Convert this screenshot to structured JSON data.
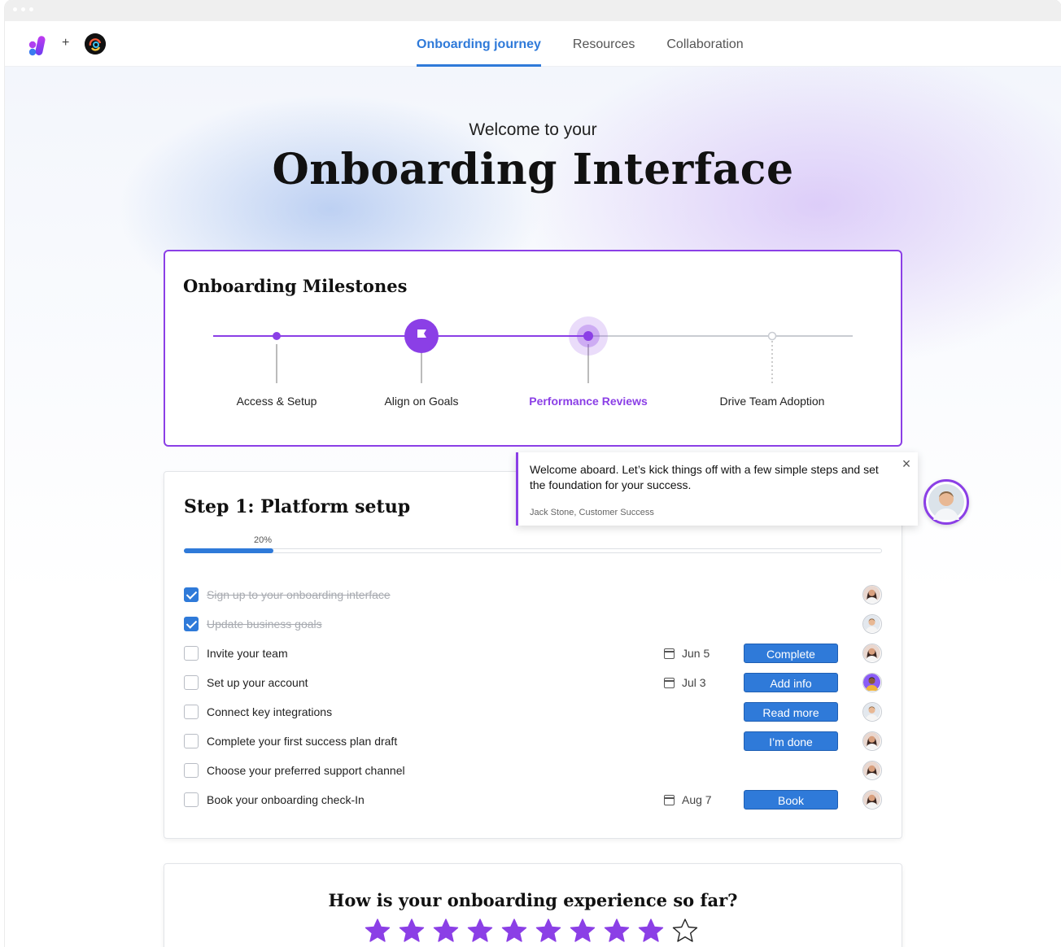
{
  "nav": {
    "plus": "+",
    "tabs": [
      {
        "label": "Onboarding journey",
        "active": true
      },
      {
        "label": "Resources",
        "active": false
      },
      {
        "label": "Collaboration",
        "active": false
      }
    ]
  },
  "hero": {
    "welcome": "Welcome to your",
    "title": "Onboarding Interface"
  },
  "milestones": {
    "title": "Onboarding Milestones",
    "items": [
      {
        "label": "Access & Setup",
        "state": "done"
      },
      {
        "label": "Align on Goals",
        "state": "done",
        "icon": "flag-icon"
      },
      {
        "label": "Performance Reviews",
        "state": "current"
      },
      {
        "label": "Drive Team Adoption",
        "state": "upcoming"
      }
    ],
    "accent": "#8b3fe6"
  },
  "tooltip": {
    "message": "Welcome aboard. Let’s kick things off with a few simple steps and set the foundation for your success.",
    "author": "Jack Stone, Customer Success",
    "close": "×"
  },
  "step": {
    "title": "Step 1: Platform setup",
    "progress_label": "20%",
    "progress": 0.126,
    "tasks": [
      {
        "label": "Sign up to your onboarding interface",
        "done": true,
        "date": "",
        "button": "",
        "avatar": "woman"
      },
      {
        "label": "Update business goals",
        "done": true,
        "date": "",
        "button": "",
        "avatar": "man"
      },
      {
        "label": "Invite your team",
        "done": false,
        "date": "Jun 5",
        "button": "Complete",
        "avatar": "woman"
      },
      {
        "label": "Set up your account",
        "done": false,
        "date": "Jul 3",
        "button": "Add info",
        "avatar": "man-colorful"
      },
      {
        "label": "Connect key integrations",
        "done": false,
        "date": "",
        "button": "Read more",
        "avatar": "man"
      },
      {
        "label": "Complete your first success plan draft",
        "done": false,
        "date": "",
        "button": "I’m done",
        "avatar": "woman"
      },
      {
        "label": "Choose your preferred support channel",
        "done": false,
        "date": "",
        "button": "",
        "avatar": "woman"
      },
      {
        "label": "Book your onboarding check-In",
        "done": false,
        "date": "Aug 7",
        "button": "Book",
        "avatar": "woman"
      }
    ]
  },
  "feedback": {
    "title": "How is your onboarding experience so far?",
    "rating": 9,
    "max": 10
  },
  "colors": {
    "primary": "#2f7ad9",
    "purple": "#8b3fe6"
  }
}
